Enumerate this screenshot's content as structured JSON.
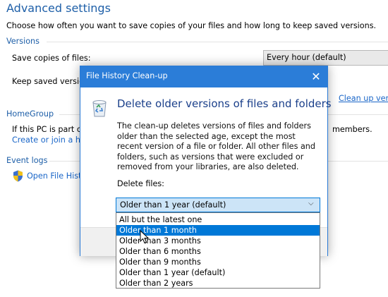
{
  "page": {
    "title": "Advanced settings",
    "subtitle": "Choose how often you want to save copies of your files and how long to keep saved versions."
  },
  "versions": {
    "group_title": "Versions",
    "save_copies_label": "Save copies of files:",
    "save_copies_value": "Every hour (default)",
    "keep_saved_label": "Keep saved versio",
    "clean_up_link": "Clean up vers"
  },
  "homegroup": {
    "group_title": "HomeGroup",
    "text_start": "If this PC is part of",
    "text_end": "members.",
    "create_link": "Create or join a ho"
  },
  "event_logs": {
    "group_title": "Event logs",
    "open_link": "Open File Hist"
  },
  "dialog": {
    "title": "File History Clean-up",
    "close_glyph": "✕",
    "heading": "Delete older versions of files and folders",
    "description": "The clean-up deletes versions of files and folders older than the selected age, except the most recent version of a file or folder. All other files and folders, such as versions that were excluded or removed from your libraries, are also deleted.",
    "delete_files_label": "Delete files:",
    "selected_value": "Older than 1 year (default)",
    "dropdown_arrow": "⌵",
    "options": [
      "All but the latest one",
      "Older than 1 month",
      "Older than 3 months",
      "Older than 6 months",
      "Older than 9 months",
      "Older than 1 year (default)",
      "Older than 2 years"
    ],
    "highlighted_option_index": 1,
    "icon": "recycle-bin-icon"
  },
  "colors": {
    "accent": "#0078d7",
    "titlebar": "#2b7dd8",
    "heading": "#1a3f8a",
    "link": "#1a66c8"
  }
}
